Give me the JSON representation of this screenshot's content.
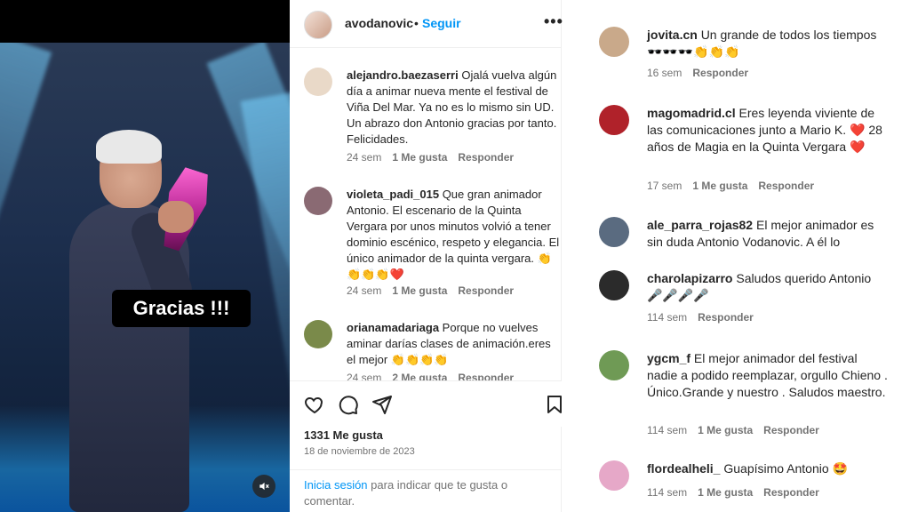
{
  "post": {
    "author": "avodanovic",
    "separator": "•",
    "follow": "Seguir",
    "more": "•••",
    "overlay_caption": "Gracias !!!",
    "mute_icon": "speaker-muted-icon",
    "likes": "1331 Me gusta",
    "date": "18 de noviembre de 2023",
    "login_link": "Inicia sesión",
    "login_text": " para indicar que te gusta o comentar."
  },
  "middle_comments": [
    {
      "user": "alejandro.baezaserri",
      "text": "Ojalá vuelva algún día a animar nueva mente el festival de Viña Del Mar. Ya no es lo mismo sin UD. Un abrazo don Antonio gracias por tanto. Felicidades.",
      "time": "24 sem",
      "likes": "1 Me gusta",
      "reply": "Responder",
      "avatar_color": "#e9d9c8"
    },
    {
      "user": "violeta_padi_015",
      "text": "Que gran animador Antonio. El escenario de la Quinta Vergara por unos minutos volvió a tener dominio escénico, respeto y elegancia. El único animador de la quinta vergara. 👏👏👏👏❤️",
      "time": "24 sem",
      "likes": "1 Me gusta",
      "reply": "Responder",
      "avatar_color": "#8a6a73"
    },
    {
      "user": "orianamadariaga",
      "text": "Porque no vuelves aminar darías clases de animación.eres el mejor 👏👏👏👏",
      "time": "24 sem",
      "likes": "2 Me gusta",
      "reply": "Responder",
      "avatar_color": "#7a8a4a"
    }
  ],
  "right_comments": [
    {
      "user": "jovita.cn",
      "text": "Un grande de todos los tiempos 🕶️🕶️🕶️👏👏👏",
      "time": "16 sem",
      "likes": "",
      "reply": "Responder",
      "avatar_color": "#c9a98a"
    },
    {
      "user": "magomadrid.cl",
      "text": "Eres leyenda viviente de las comunicaciones junto a Mario K. ❤️ 28 años de Magia en la Quinta Vergara ❤️",
      "time": "17 sem",
      "likes": "1 Me gusta",
      "reply": "Responder",
      "avatar_color": "#b0222a"
    },
    {
      "user": "ale_parra_rojas82",
      "text": "El mejor animador es sin duda Antonio Vodanovic. A él lo",
      "time": "",
      "likes": "",
      "reply": "",
      "avatar_color": "#5a6b80"
    },
    {
      "user": "charolapizarro",
      "text": "Saludos querido Antonio 🎤🎤🎤🎤",
      "time": "114 sem",
      "likes": "",
      "reply": "Responder",
      "avatar_color": "#2b2b2b"
    },
    {
      "user": "ygcm_f",
      "text": "El mejor animador del festival nadie a podido reemplazar, orgullo Chieno . Único.Grande y nuestro . Saludos maestro.",
      "time": "114 sem",
      "likes": "1 Me gusta",
      "reply": "Responder",
      "avatar_color": "#6f9a55"
    },
    {
      "user": "flordealheli_",
      "text": "Guapísimo Antonio 🤩",
      "time": "114 sem",
      "likes": "1 Me gusta",
      "reply": "Responder",
      "avatar_color": "#e6a8c8"
    }
  ]
}
